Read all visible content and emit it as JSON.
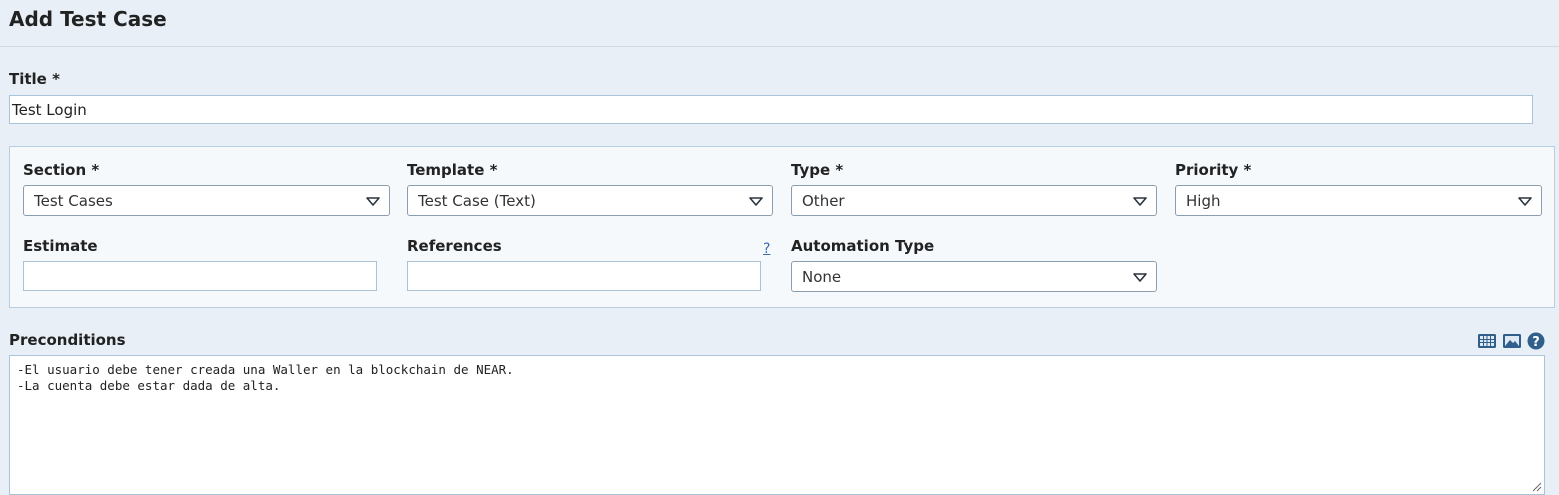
{
  "page": {
    "title": "Add Test Case"
  },
  "title_field": {
    "label": "Title *",
    "value": "Test Login"
  },
  "section": {
    "label": "Section *",
    "value": "Test Cases"
  },
  "template": {
    "label": "Template *",
    "value": "Test Case (Text)"
  },
  "type": {
    "label": "Type *",
    "value": "Other"
  },
  "priority": {
    "label": "Priority *",
    "value": "High"
  },
  "estimate": {
    "label": "Estimate",
    "value": ""
  },
  "references": {
    "label": "References",
    "value": "",
    "help": "?"
  },
  "automation_type": {
    "label": "Automation Type",
    "value": "None"
  },
  "preconditions": {
    "label": "Preconditions",
    "lines": [
      "-El usuario debe tener creada una Waller en la blockchain de NEAR.",
      "-La cuenta debe estar dada de alta."
    ],
    "toolbar_icons": [
      "table-icon",
      "image-icon",
      "help-icon"
    ]
  },
  "colors": {
    "accent": "#2f5f8a",
    "background": "#e8eff6",
    "panel": "#f5f9fc"
  }
}
